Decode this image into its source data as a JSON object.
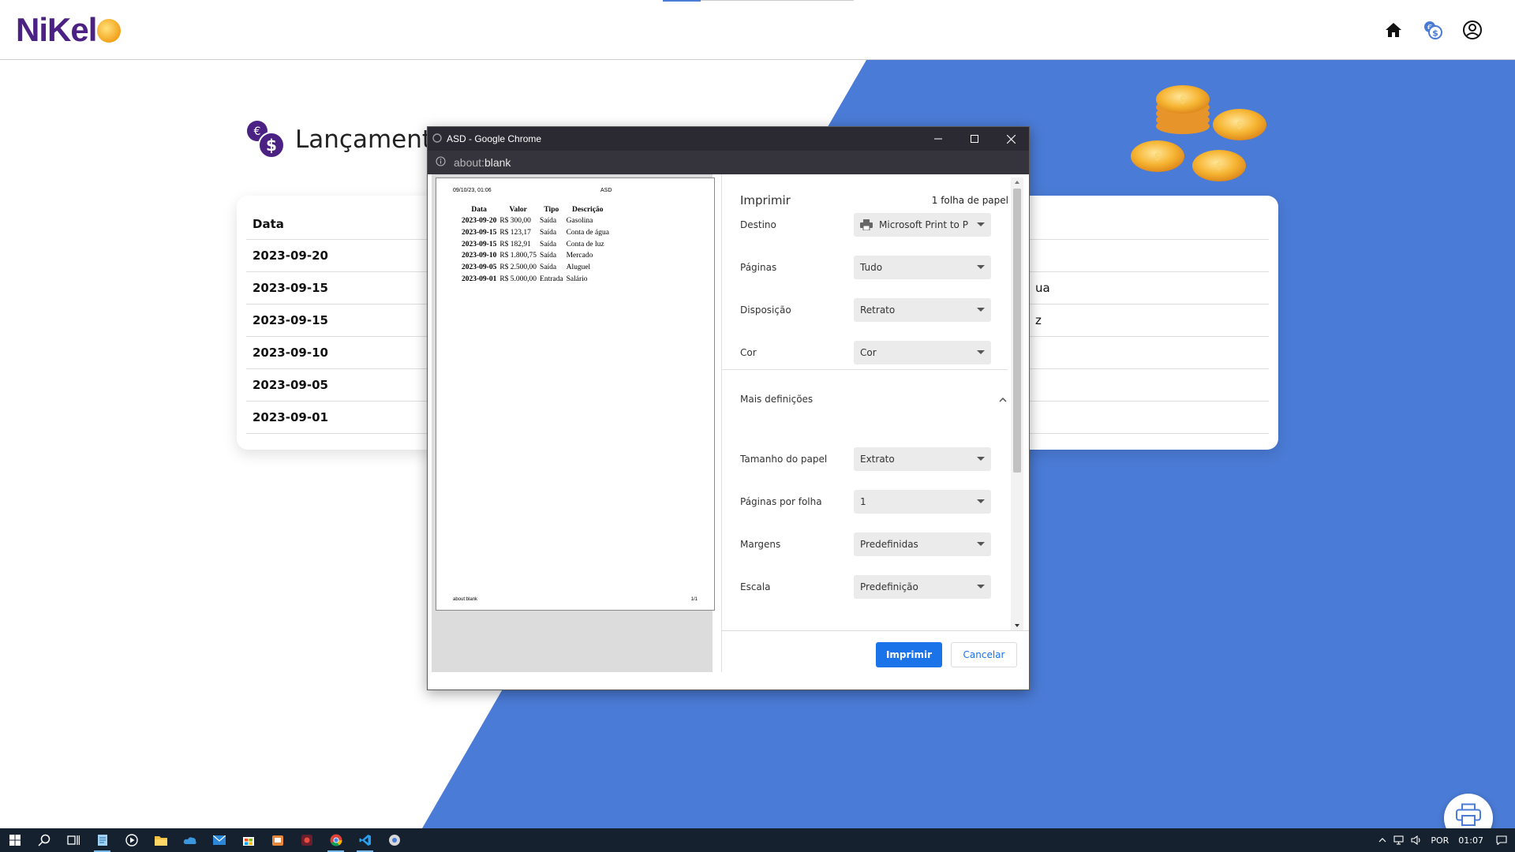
{
  "app": {
    "logo_text": "NiKel",
    "header_icons": [
      "home-icon",
      "currency-exchange-icon",
      "account-circle-icon"
    ],
    "page_title": "Lançamentos"
  },
  "table": {
    "header_date": "Data",
    "rows": [
      {
        "date": "2023-09-20",
        "desc": ""
      },
      {
        "date": "2023-09-15",
        "desc": "ua"
      },
      {
        "date": "2023-09-15",
        "desc": "z"
      },
      {
        "date": "2023-09-10",
        "desc": ""
      },
      {
        "date": "2023-09-05",
        "desc": ""
      },
      {
        "date": "2023-09-01",
        "desc": ""
      }
    ]
  },
  "dialog": {
    "window_title": "ASD - Google Chrome",
    "address_scheme": "about:",
    "address_path": "blank",
    "preview": {
      "header_date": "09/10/23, 01:06",
      "header_title": "ASD",
      "columns": [
        "Data",
        "Valor",
        "Tipo",
        "Descrição"
      ],
      "rows": [
        [
          "2023-09-20",
          "R$ 300,00",
          "Saída",
          "Gasolina"
        ],
        [
          "2023-09-15",
          "R$ 123,17",
          "Saída",
          "Conta de água"
        ],
        [
          "2023-09-15",
          "R$ 182,91",
          "Saída",
          "Conta de luz"
        ],
        [
          "2023-09-10",
          "R$ 1.800,75",
          "Saída",
          "Mercado"
        ],
        [
          "2023-09-05",
          "R$ 2.500,00",
          "Saída",
          "Aluguel"
        ],
        [
          "2023-09-01",
          "R$ 5.000,00",
          "Entrada",
          "Salário"
        ]
      ],
      "footer_left": "about:blank",
      "footer_right": "1/1"
    },
    "settings": {
      "title": "Imprimir",
      "sheet_count": "1 folha de papel",
      "destination_label": "Destino",
      "destination_value": "Microsoft Print to P",
      "pages_label": "Páginas",
      "pages_value": "Tudo",
      "layout_label": "Disposição",
      "layout_value": "Retrato",
      "color_label": "Cor",
      "color_value": "Cor",
      "more_label": "Mais definições",
      "paper_size_label": "Tamanho do papel",
      "paper_size_value": "Extrato",
      "pages_per_sheet_label": "Páginas por folha",
      "pages_per_sheet_value": "1",
      "margins_label": "Margens",
      "margins_value": "Predefinidas",
      "scale_label": "Escala",
      "scale_value": "Predefinição"
    },
    "print_button": "Imprimir",
    "cancel_button": "Cancelar"
  },
  "taskbar": {
    "language": "POR",
    "time": "01:07"
  },
  "colors": {
    "brand_purple": "#4b2184",
    "blue_bg": "#4a7bd6",
    "primary_button": "#1a73e8",
    "dialog_titlebar": "#2b2a33",
    "taskbar": "#15212f"
  }
}
